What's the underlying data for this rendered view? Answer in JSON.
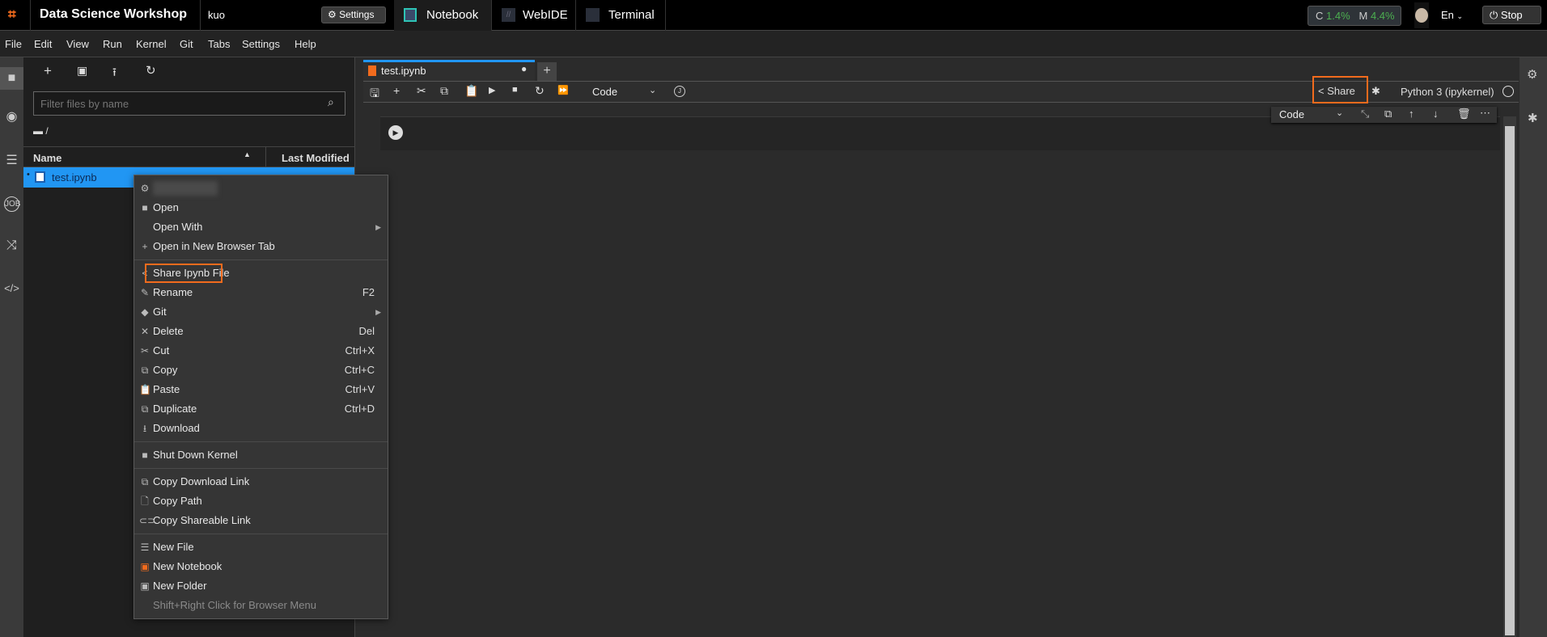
{
  "topbar": {
    "app_title": "Data Science Workshop",
    "user": "kuo",
    "settings_label": "Settings",
    "tabs": [
      {
        "label": "Notebook"
      },
      {
        "label": "WebIDE"
      },
      {
        "label": "Terminal"
      }
    ],
    "cpu_label": "C",
    "cpu_value": "1.4%",
    "mem_label": "M",
    "mem_value": "4.4%",
    "language": "En",
    "stop_label": "Stop"
  },
  "menubar": [
    "File",
    "Edit",
    "View",
    "Run",
    "Kernel",
    "Git",
    "Tabs",
    "Settings",
    "Help"
  ],
  "filebrowser": {
    "filter_placeholder": "Filter files by name",
    "breadcrumb": "/",
    "col_name": "Name",
    "col_modified": "Last Modified",
    "files": [
      {
        "name": "test.ipynb"
      }
    ]
  },
  "notebook": {
    "tab_label": "test.ipynb",
    "cell_type": "Code",
    "share_label": "Share",
    "kernel": "Python 3 (ipykernel)",
    "cell_toolbar_type": "Code"
  },
  "context_menu": [
    {
      "label": "",
      "icon": "chip-icon",
      "blurred": true
    },
    {
      "label": "Open",
      "icon": "folder-icon"
    },
    {
      "label": "Open With",
      "submenu": true
    },
    {
      "label": "Open in New Browser Tab",
      "icon": "plus-icon"
    },
    {
      "sep": true
    },
    {
      "label": "Share Ipynb File",
      "icon": "share-icon",
      "highlight": true
    },
    {
      "label": "Rename",
      "icon": "pencil-icon",
      "shortcut": "F2"
    },
    {
      "label": "Git",
      "icon": "git-icon",
      "submenu": true
    },
    {
      "label": "Delete",
      "icon": "close-icon",
      "shortcut": "Del"
    },
    {
      "label": "Cut",
      "icon": "scissors-icon",
      "shortcut": "Ctrl+X"
    },
    {
      "label": "Copy",
      "icon": "copy-icon",
      "shortcut": "Ctrl+C"
    },
    {
      "label": "Paste",
      "icon": "paste-icon",
      "shortcut": "Ctrl+V"
    },
    {
      "label": "Duplicate",
      "icon": "copy-icon",
      "shortcut": "Ctrl+D"
    },
    {
      "label": "Download",
      "icon": "download-icon"
    },
    {
      "sep": true
    },
    {
      "label": "Shut Down Kernel",
      "icon": "stop-icon"
    },
    {
      "sep": true
    },
    {
      "label": "Copy Download Link",
      "icon": "copy-icon"
    },
    {
      "label": "Copy Path",
      "icon": "file-icon"
    },
    {
      "label": "Copy Shareable Link",
      "icon": "link-icon"
    },
    {
      "sep": true
    },
    {
      "label": "New File",
      "icon": "text-file-icon"
    },
    {
      "label": "New Notebook",
      "icon": "notebook-icon"
    },
    {
      "label": "New Folder",
      "icon": "new-folder-icon"
    },
    {
      "label": "Shift+Right Click for Browser Menu",
      "disabled": true
    }
  ],
  "colors": {
    "accent": "#f26b1d",
    "selection": "#2196f3",
    "green": "#4caf50"
  }
}
